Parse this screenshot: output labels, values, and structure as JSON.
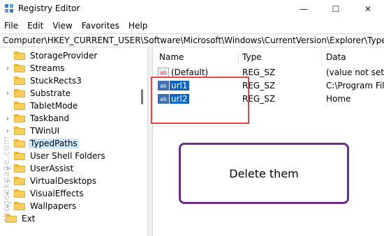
{
  "window": {
    "title": "Registry Editor",
    "minimize_glyph": "—",
    "maximize_glyph": "☐",
    "close_glyph": "✕"
  },
  "menu": [
    "File",
    "Edit",
    "View",
    "Favorites",
    "Help"
  ],
  "address": "Computer\\HKEY_CURRENT_USER\\Software\\Microsoft\\Windows\\CurrentVersion\\Explorer\\TypedPaths",
  "tree": {
    "items": [
      {
        "label": "StorageProvider",
        "expandable": false,
        "selected": false
      },
      {
        "label": "Streams",
        "expandable": true,
        "selected": false
      },
      {
        "label": "StuckRects3",
        "expandable": false,
        "selected": false
      },
      {
        "label": "Substrate",
        "expandable": true,
        "selected": false
      },
      {
        "label": "TabletMode",
        "expandable": false,
        "selected": false
      },
      {
        "label": "Taskband",
        "expandable": true,
        "selected": false
      },
      {
        "label": "TWinUI",
        "expandable": true,
        "selected": false
      },
      {
        "label": "TypedPaths",
        "expandable": false,
        "selected": true
      },
      {
        "label": "User Shell Folders",
        "expandable": false,
        "selected": false
      },
      {
        "label": "UserAssist",
        "expandable": true,
        "selected": false
      },
      {
        "label": "VirtualDesktops",
        "expandable": true,
        "selected": false
      },
      {
        "label": "VisualEffects",
        "expandable": true,
        "selected": false
      },
      {
        "label": "Wallpapers",
        "expandable": true,
        "selected": false
      }
    ],
    "last_item": {
      "label": "Ext",
      "expandable": true
    }
  },
  "list": {
    "columns": [
      "Name",
      "Type",
      "Data"
    ],
    "rows": [
      {
        "name": "(Default)",
        "type": "REG_SZ",
        "data": "(value not set)",
        "icon": "ab",
        "selected": false
      },
      {
        "name": "url1",
        "type": "REG_SZ",
        "data": "C:\\Program File",
        "icon": "ab",
        "selected": true
      },
      {
        "name": "url2",
        "type": "REG_SZ",
        "data": "Home",
        "icon": "ab",
        "selected": true
      }
    ]
  },
  "annotation": {
    "callout_text": "Delete them",
    "box_color": "#e04848",
    "callout_color": "#6a2c91"
  },
  "watermark": "thegeekpage.com",
  "colors": {
    "selection": "#0b64c8",
    "tree_selection": "#cce8ff",
    "folder": "#f8cf5a"
  }
}
